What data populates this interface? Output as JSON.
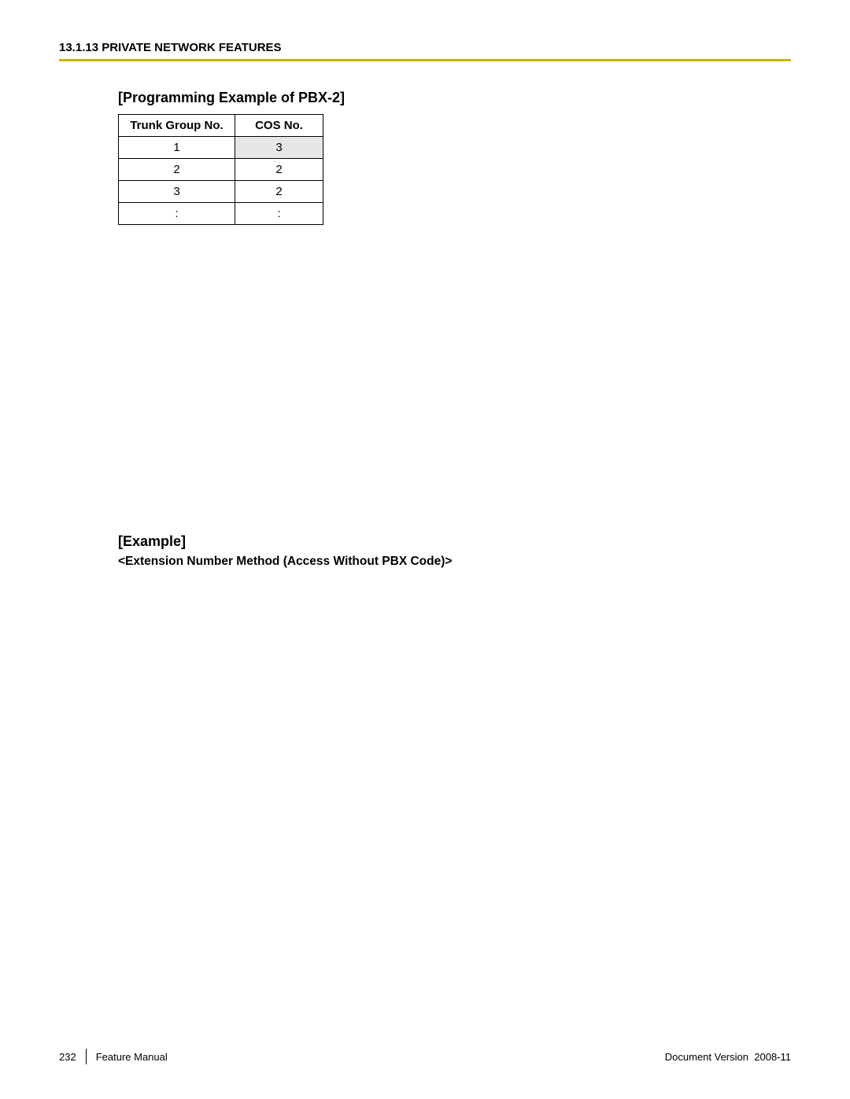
{
  "header": {
    "section_title": "13.1.13 PRIVATE NETWORK FEATURES"
  },
  "content": {
    "programming_title": "[Programming Example of PBX-2]",
    "table": {
      "headers": {
        "col1": "Trunk Group No.",
        "col2": "COS No."
      },
      "rows": [
        {
          "col1": "1",
          "col2": "3",
          "highlight": true
        },
        {
          "col1": "2",
          "col2": "2"
        },
        {
          "col1": "3",
          "col2": "2"
        },
        {
          "col1": ":",
          "col2": ":"
        }
      ]
    },
    "example_title": "[Example]",
    "example_subtitle": "<Extension Number Method (Access Without PBX Code)>"
  },
  "footer": {
    "page_number": "232",
    "manual_name": "Feature Manual",
    "doc_version_label": "Document Version",
    "doc_version_value": "2008-11"
  }
}
